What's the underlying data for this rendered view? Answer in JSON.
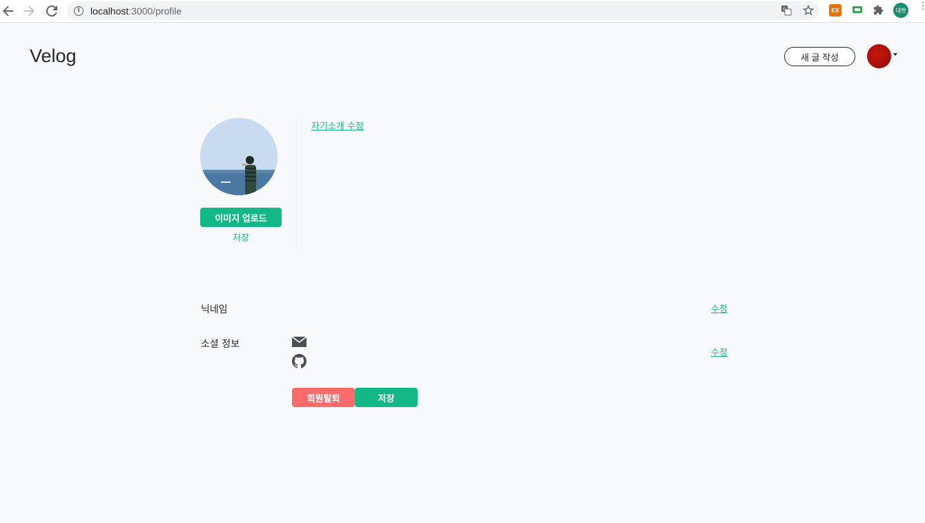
{
  "browser": {
    "url_host": "localhost",
    "url_path": ":3000/profile",
    "profile_initials": "대현",
    "ext1": "EX"
  },
  "header": {
    "logo": "Velog",
    "write_button": "새 글 작성"
  },
  "profile": {
    "upload_button": "이미지 업로드",
    "save_link": "저장",
    "intro_edit": "자기소개 수정"
  },
  "settings": {
    "nickname_label": "닉네임",
    "nickname_edit": "수정",
    "social_label": "소셜 정보",
    "social_edit": "수정",
    "social_icons": [
      "mail-icon",
      "github-icon"
    ],
    "delete_button": "회원탈퇴",
    "save_button": "저장"
  },
  "colors": {
    "accent": "#12b886",
    "danger": "#ff6b6b",
    "background": "#f8f9fa"
  }
}
